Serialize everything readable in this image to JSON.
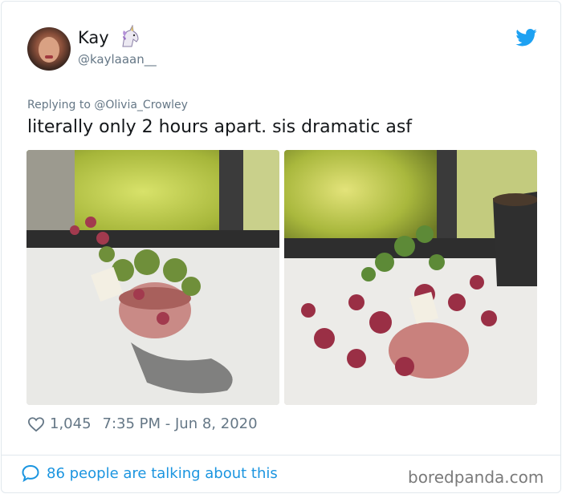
{
  "user": {
    "name": "Kay",
    "emoji_icon": "unicorn-icon",
    "handle": "@kaylaaan__"
  },
  "tweet": {
    "replying_to": "Replying to @Olivia_Crowley",
    "text": "literally only 2 hours apart. sis dramatic asf",
    "likes": "1,045",
    "timestamp": "7:35 PM - Jun 8, 2020"
  },
  "footer": {
    "conversation": "86 people are talking about this"
  },
  "watermark": "boredpanda.com",
  "colors": {
    "twitter_blue": "#1da1f2",
    "link_blue": "#1b95e0",
    "secondary_text": "#657786"
  }
}
